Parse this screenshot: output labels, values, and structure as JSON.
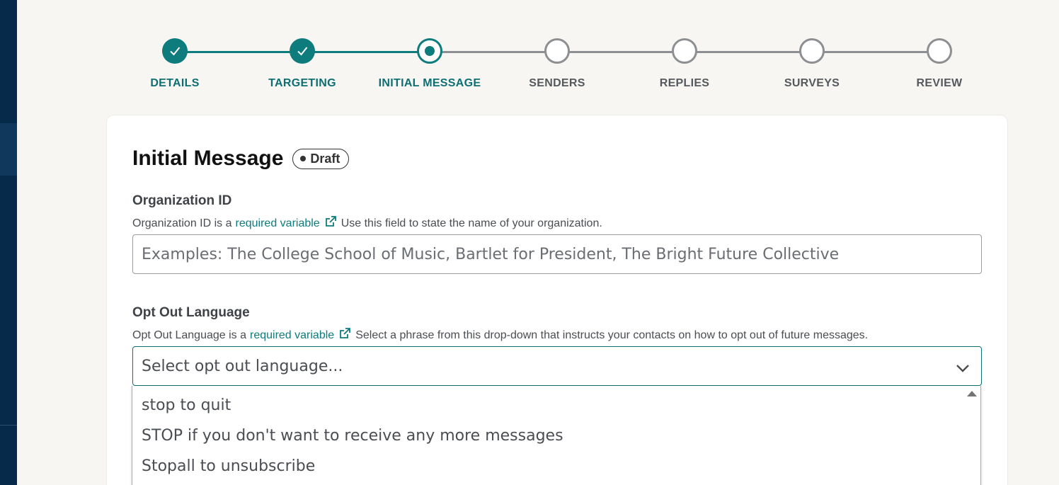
{
  "stepper": {
    "steps": [
      {
        "label": "DETAILS",
        "state": "done"
      },
      {
        "label": "TARGETING",
        "state": "done"
      },
      {
        "label": "INITIAL MESSAGE",
        "state": "current"
      },
      {
        "label": "SENDERS",
        "state": "todo"
      },
      {
        "label": "REPLIES",
        "state": "todo"
      },
      {
        "label": "SURVEYS",
        "state": "todo"
      },
      {
        "label": "REVIEW",
        "state": "todo"
      }
    ]
  },
  "card": {
    "title": "Initial Message",
    "badge": "Draft",
    "org_field": {
      "label": "Organization ID",
      "help_prefix": "Organization ID is a",
      "help_link": "required variable",
      "help_suffix": "Use this field to state the name of your organization.",
      "placeholder": "Examples: The College School of Music, Bartlet for President, The Bright Future Collective"
    },
    "optout_field": {
      "label": "Opt Out Language",
      "help_prefix": "Opt Out Language is a",
      "help_link": "required variable",
      "help_suffix": "Select a phrase from this drop-down that instructs your contacts on how to opt out of future messages.",
      "placeholder": "Select opt out language...",
      "options": [
        "stop to quit",
        "STOP if you don't want to receive any more messages",
        "Stopall to unsubscribe"
      ]
    }
  },
  "colors": {
    "accent": "#0e7b7d",
    "rail": "#062a4a",
    "inactive": "#8d8f92"
  }
}
